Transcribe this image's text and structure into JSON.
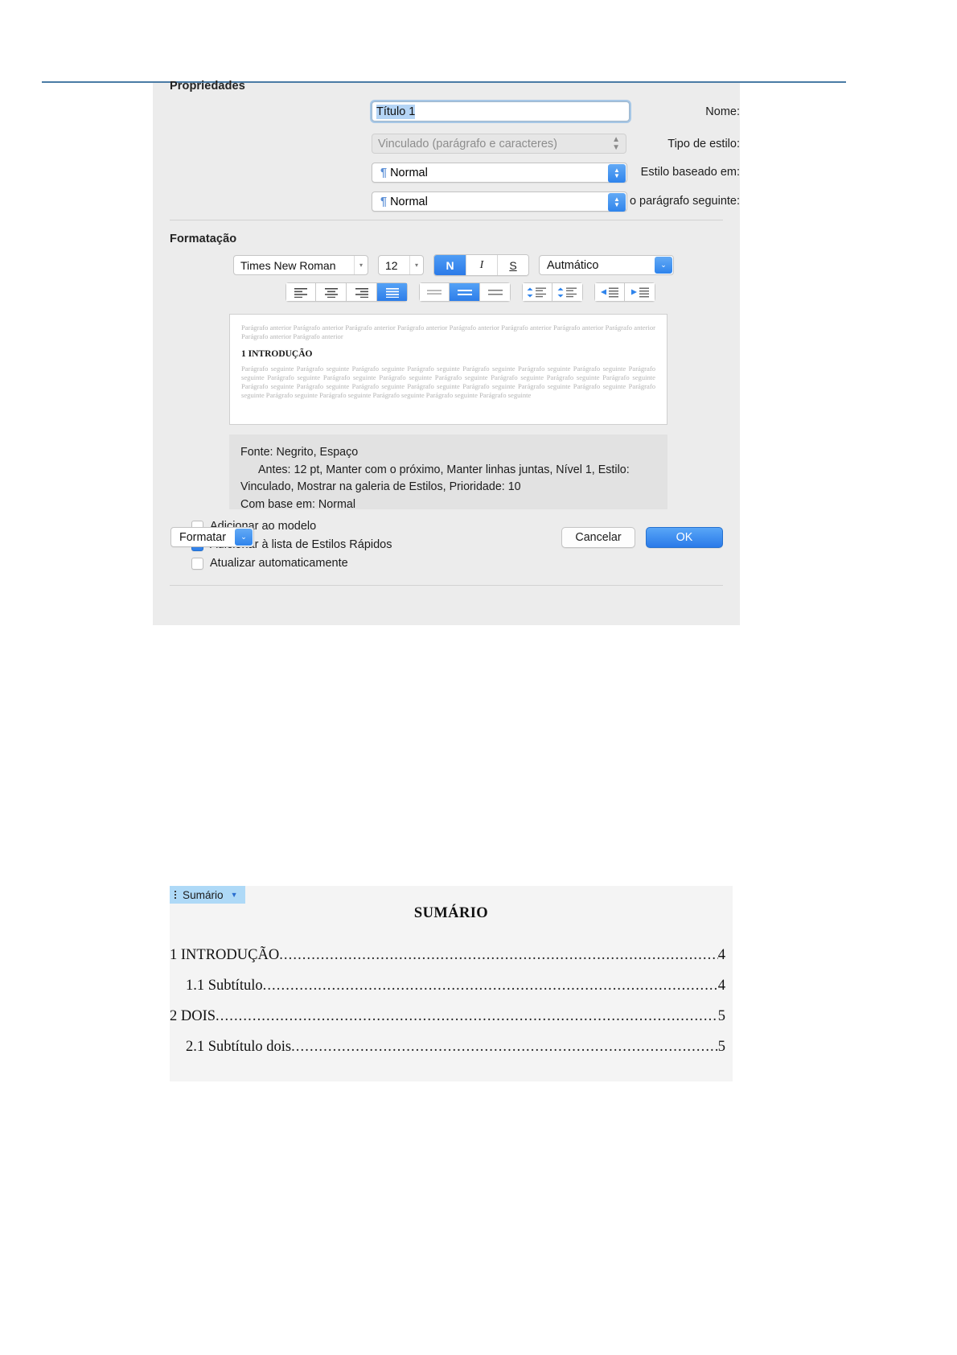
{
  "dialog": {
    "sections": {
      "properties": "Propriedades",
      "formatting": "Formatação"
    },
    "fields": {
      "name_label": "Nome:",
      "name_value": "Título 1",
      "style_type_label": "Tipo de estilo:",
      "style_type_value": "Vinculado (parágrafo e caracteres)",
      "based_on_label": "Estilo baseado em:",
      "based_on_value": "Normal",
      "next_style_label": "Estilo para o parágrafo seguinte:",
      "next_style_value": "Normal"
    },
    "toolbar": {
      "font_family": "Times New Roman",
      "font_size": "12",
      "bold_label": "N",
      "italic_label": "I",
      "underline_label": "S",
      "font_color": "Autmático",
      "align": [
        "align-left",
        "align-center",
        "align-right",
        "align-justify"
      ],
      "align_active": 3,
      "line_spacing": [
        "spacing-single",
        "spacing-one-half",
        "spacing-double"
      ],
      "line_spacing_active": 1,
      "space_before_icon": "decrease-space-before",
      "space_after_icon": "increase-space-after",
      "decrease_indent_icon": "decrease-indent",
      "increase_indent_icon": "increase-indent"
    },
    "preview": {
      "before_text": "Parágrafo anterior Parágrafo anterior Parágrafo anterior Parágrafo anterior Parágrafo anterior Parágrafo anterior Parágrafo anterior Parágrafo anterior Parágrafo anterior Parágrafo anterior",
      "heading": "1 INTRODUÇÃO",
      "after_text": "Parágrafo seguinte Parágrafo seguinte Parágrafo seguinte Parágrafo seguinte Parágrafo seguinte Parágrafo seguinte Parágrafo seguinte Parágrafo seguinte Parágrafo seguinte Parágrafo seguinte Parágrafo seguinte Parágrafo seguinte Parágrafo seguinte Parágrafo seguinte Parágrafo seguinte Parágrafo seguinte Parágrafo seguinte Parágrafo seguinte Parágrafo seguinte Parágrafo seguinte Parágrafo seguinte Parágrafo seguinte Parágrafo seguinte Parágrafo seguinte Parágrafo seguinte Parágrafo seguinte Parágrafo seguinte Parágrafo seguinte"
    },
    "description": {
      "line1": "Fonte: Negrito, Espaço",
      "line2": "Antes:  12 pt, Manter com o próximo, Manter linhas juntas, Nível 1, Estilo:",
      "line3": "Vinculado, Mostrar na galeria de Estilos, Prioridade: 10",
      "line4": "Com base em: Normal"
    },
    "checkboxes": [
      {
        "label": "Adicionar ao modelo",
        "checked": false
      },
      {
        "label": "Adicionar à lista de Estilos Rápidos",
        "checked": true
      },
      {
        "label": "Atualizar automaticamente",
        "checked": false
      }
    ],
    "footer": {
      "format_label": "Formatar",
      "cancel_label": "Cancelar",
      "ok_label": "OK"
    }
  },
  "toc": {
    "tab_label": "Sumário",
    "title": "SUMÁRIO",
    "entries": [
      {
        "text": "1 INTRODUÇÃO",
        "page": "4",
        "level": 1
      },
      {
        "text": "1.1 Subtítulo ",
        "page": "4",
        "level": 2
      },
      {
        "text": "2 DOIS",
        "page": "5",
        "level": 1
      },
      {
        "text": "2.1 Subtítulo dois",
        "page": "5",
        "level": 2
      }
    ]
  },
  "colors": {
    "accent": "#2f84ec",
    "tab_highlight": "#aed9f7",
    "dialog_bg": "#ececec",
    "rule": "#4a7ba5"
  }
}
